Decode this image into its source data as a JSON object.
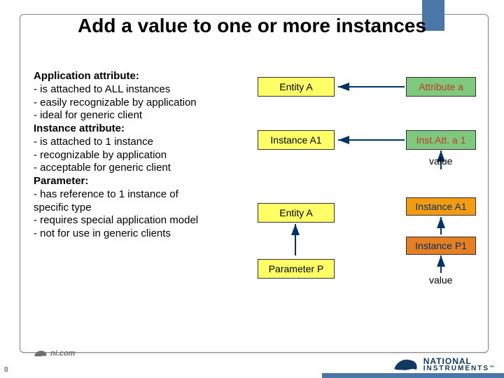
{
  "title": "Add a value to one or more instances",
  "body": {
    "app_hdr": "Application attribute:",
    "app_b1": " - is attached to ALL instances",
    "app_b2": " - easily recognizable by application",
    "app_b3": " - ideal for generic client",
    "inst_hdr": "Instance attribute:",
    "inst_b1": " - is attached to 1 instance",
    "inst_b2": " - recognizable by application",
    "inst_b3": " - acceptable for generic client",
    "param_hdr": "Parameter:",
    "param_b1": " - has reference to 1 instance of",
    "param_b2": "   specific type",
    "param_b3": " - requires special application model",
    "param_b4": " - not for use in generic clients"
  },
  "diagram": {
    "entity_a_1": "Entity A",
    "attr_a": "Attribute a",
    "instance_a1_1": "Instance A1",
    "inst_att_a1": "Inst.Att. a 1",
    "value_top": "value",
    "entity_a_2": "Entity A",
    "instance_a1_2": "Instance A1",
    "parameter_p": "Parameter P",
    "instance_p1": "Instance P1",
    "value_bottom": "value"
  },
  "footer": {
    "small_url": "ni.com",
    "big_line1": "NATIONAL",
    "big_line2": "INSTRUMENTS",
    "tm": "™"
  },
  "page_number": "8"
}
